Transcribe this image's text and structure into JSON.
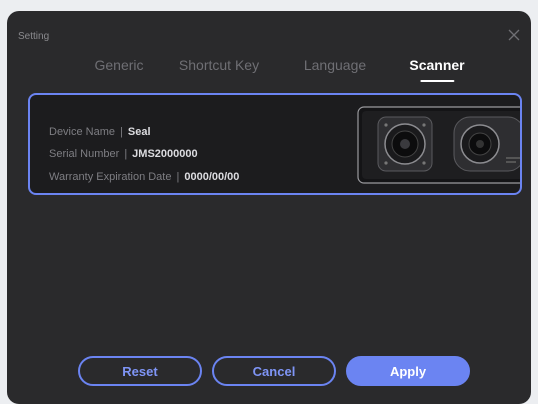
{
  "dialog": {
    "title": "Setting",
    "close_icon": "close-icon"
  },
  "tabs": [
    {
      "label": "Generic",
      "active": false
    },
    {
      "label": "Shortcut Key",
      "active": false
    },
    {
      "label": "Language",
      "active": false
    },
    {
      "label": "Scanner",
      "active": true
    }
  ],
  "device": {
    "name_label": "Device Name",
    "name_value": "Seal",
    "serial_label": "Serial Number",
    "serial_value": "JMS2000000",
    "warranty_label": "Warranty Expiration Date",
    "warranty_value": "0000/00/00",
    "separator": "|",
    "image_icon": "scanner-device-image"
  },
  "buttons": {
    "reset": "Reset",
    "cancel": "Cancel",
    "apply": "Apply"
  },
  "colors": {
    "accent": "#6b84f2",
    "dialog_bg": "#2a2a2c",
    "card_bg": "#1c1c1e"
  }
}
